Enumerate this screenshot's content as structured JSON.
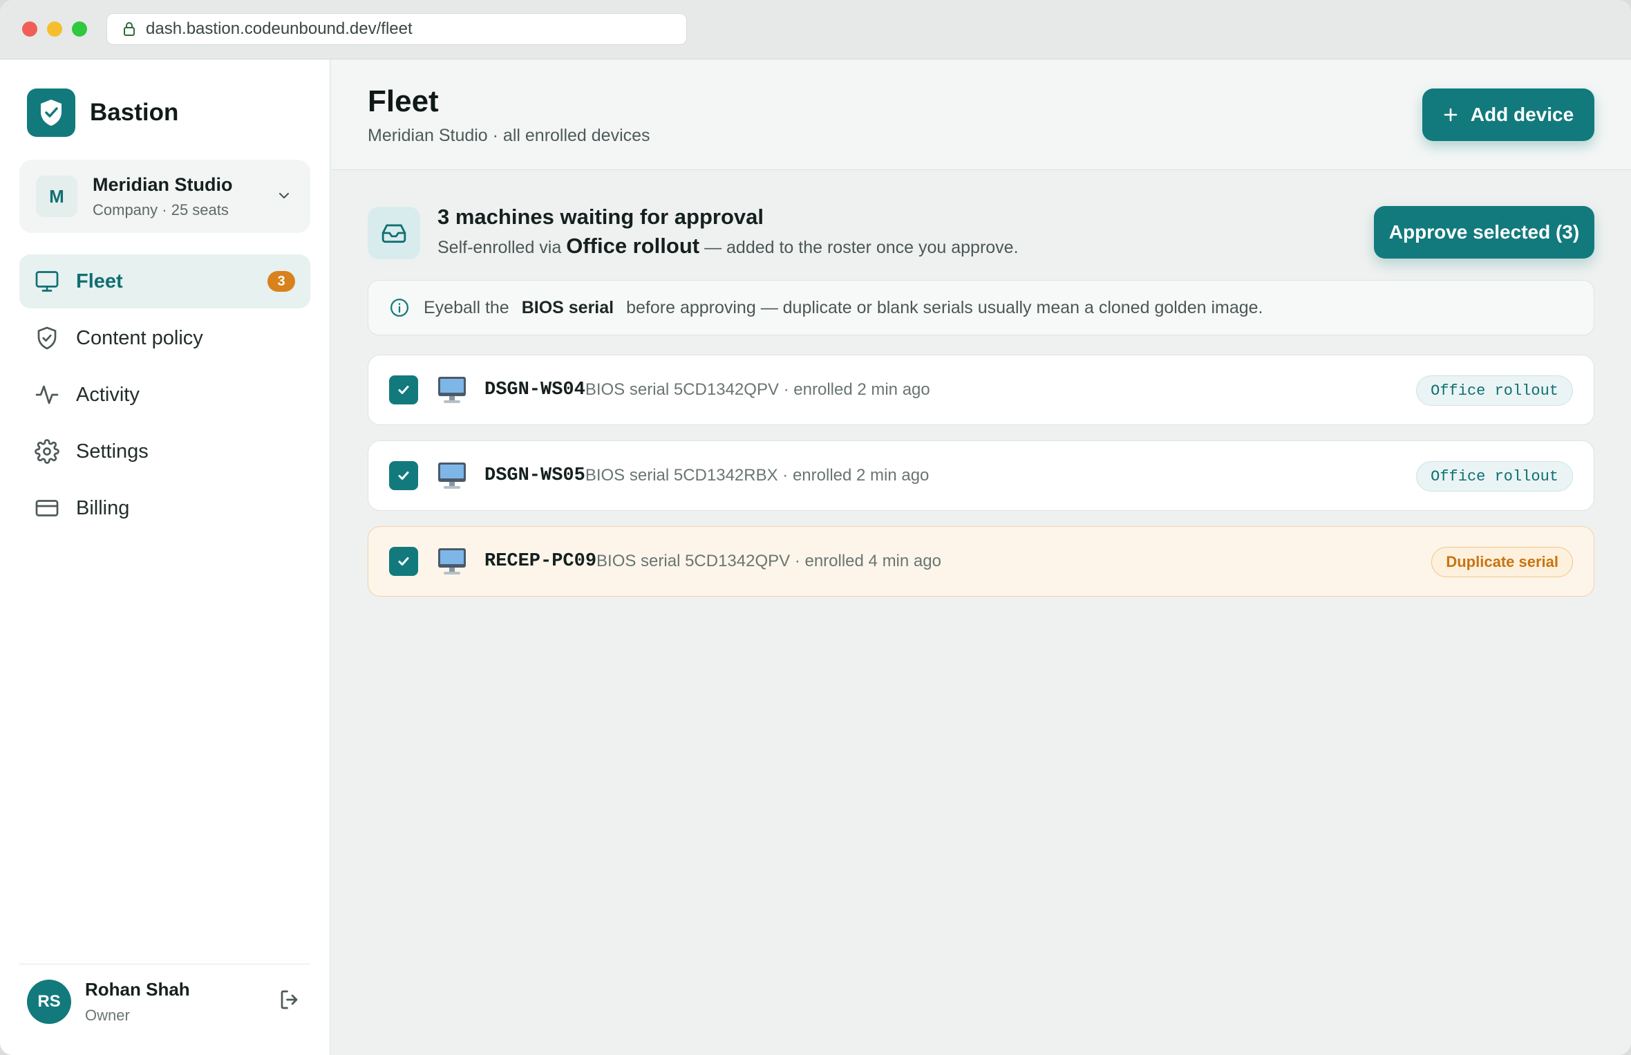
{
  "browser": {
    "url": "dash.bastion.codeunbound.dev/fleet"
  },
  "brand": {
    "name": "Bastion"
  },
  "org": {
    "initial": "M",
    "name": "Meridian Studio",
    "sub": "Company · 25 seats"
  },
  "nav": [
    {
      "label": "Fleet",
      "icon": "monitor-icon",
      "active": true,
      "badge": "3"
    },
    {
      "label": "Content policy",
      "icon": "shield-icon"
    },
    {
      "label": "Activity",
      "icon": "activity-icon"
    },
    {
      "label": "Settings",
      "icon": "gear-icon"
    },
    {
      "label": "Billing",
      "icon": "credit-card-icon"
    }
  ],
  "user": {
    "initials": "RS",
    "name": "Rohan Shah",
    "role": "Owner"
  },
  "header": {
    "title": "Fleet",
    "subtitle": "Meridian Studio · all enrolled devices",
    "add_button": "Add device"
  },
  "approval": {
    "title": "3 machines waiting for approval",
    "sub_prefix": "Self-enrolled via",
    "sub_strong": "Office rollout",
    "sub_suffix": "— added to the roster once you approve.",
    "approve_button": "Approve selected (3)"
  },
  "info": {
    "prefix": "Eyeball the",
    "strong": "BIOS serial",
    "suffix": "before approving — duplicate or blank serials usually mean a cloned golden image."
  },
  "devices": [
    {
      "name": "DSGN-WS04",
      "meta": "BIOS serial 5CD1342QPV · enrolled 2 min ago",
      "tag": "Office rollout",
      "checked": true
    },
    {
      "name": "DSGN-WS05",
      "meta": "BIOS serial 5CD1342RBX · enrolled 2 min ago",
      "tag": "Office rollout",
      "checked": true
    },
    {
      "name": "RECEP-PC09",
      "meta": "BIOS serial 5CD1342QPV · enrolled 4 min ago",
      "tag": "Duplicate serial",
      "checked": true
    }
  ],
  "colors": {
    "accent": "#127a7d",
    "warning": "#d8821c"
  }
}
